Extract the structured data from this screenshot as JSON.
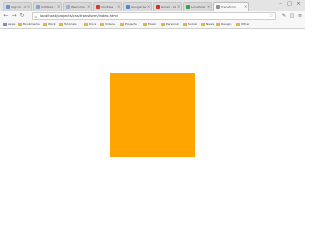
{
  "colors": {
    "box": "#ffa500",
    "tab_favicons": [
      "#6d8fce",
      "#8aa0c8",
      "#9db0d4",
      "#d13b2f",
      "#4a87d6",
      "#c8372c",
      "#3b9e4c",
      "#909090"
    ]
  },
  "tabs": [
    {
      "title": "Sign In - XAMPP",
      "icon": "page-icon"
    },
    {
      "title": "Untitled - HTML",
      "icon": "page-icon"
    },
    {
      "title": "Welcome - Admin",
      "icon": "page-icon"
    },
    {
      "title": "YouTube",
      "icon": "youtube-icon"
    },
    {
      "title": "Google Search",
      "icon": "google-icon"
    },
    {
      "title": "Gmail - Inbox",
      "icon": "mail-icon"
    },
    {
      "title": "Localhost",
      "icon": "page-icon"
    },
    {
      "title": "Transform",
      "icon": "page-icon",
      "active": true
    }
  ],
  "window_controls": {
    "minimize": "–",
    "maximize": "□",
    "close": "×"
  },
  "nav": {
    "back": "←",
    "forward": "→",
    "reload": "↻",
    "home": "⌂",
    "url": "localhost/projects/css/transform/index.html"
  },
  "bookmarks": [
    "Apps",
    "Bookmarks",
    "Work",
    "Tutorials",
    "Docs",
    "Videos",
    "Projects",
    "Music",
    "Personal",
    "Social",
    "News",
    "Design",
    "Other"
  ]
}
